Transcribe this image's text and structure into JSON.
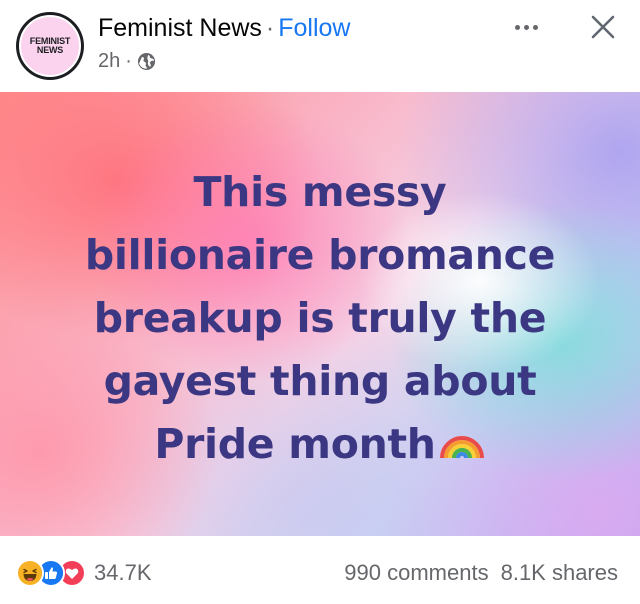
{
  "header": {
    "avatar_text_line1": "FEMINIST",
    "avatar_text_line2": "NEWS",
    "page_name": "Feminist News",
    "separator": "·",
    "follow_label": "Follow",
    "timestamp": "2h",
    "meta_separator": "·",
    "audience_icon": "globe-icon",
    "more_icon": "more-horizontal-icon",
    "close_icon": "close-icon"
  },
  "post": {
    "lines": [
      "This messy",
      "billionaire bromance",
      "breakup is truly the",
      "gayest thing about",
      "Pride month"
    ],
    "emoji": "rainbow-emoji",
    "text_color": "#3b3782"
  },
  "footer": {
    "reaction_icons": [
      "haha-icon",
      "like-icon",
      "love-icon"
    ],
    "reactions_count": "34.7K",
    "comments": "990 comments",
    "shares": "8.1K shares"
  },
  "colors": {
    "accent": "#1877f2",
    "secondary_text": "#65676b",
    "like": "#1877f2",
    "love": "#f33e58",
    "haha": "#f7b125"
  }
}
